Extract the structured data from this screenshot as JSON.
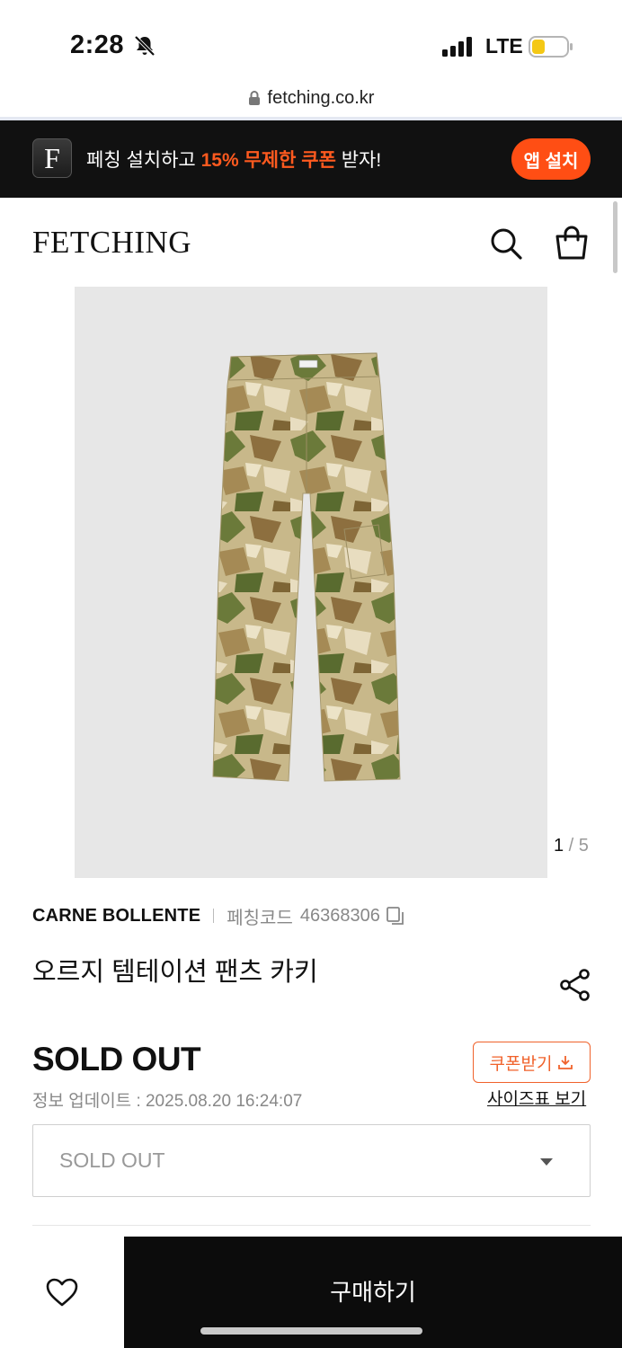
{
  "status_bar": {
    "time": "2:28",
    "network": "LTE",
    "icons": [
      "bell-slash-icon",
      "signal-icon",
      "battery-icon"
    ]
  },
  "browser": {
    "url": "fetching.co.kr"
  },
  "app_banner": {
    "logo_letter": "F",
    "text_prefix": "페칭 설치하고 ",
    "text_highlight": "15% 무제한 쿠폰",
    "text_suffix": " 받자!",
    "install_label": "앱 설치",
    "accent_color": "#ff4e14"
  },
  "header": {
    "logo": "FETCHING",
    "icons": [
      "search-icon",
      "shopping-bag-icon"
    ]
  },
  "product": {
    "image_counter": {
      "current": "1",
      "separator": " / ",
      "total": "5"
    },
    "brand": "CARNE BOLLENTE",
    "code_label": "페칭코드",
    "code_value": "46368306",
    "title": "오르지 템테이션 팬츠 카키",
    "status": "SOLD OUT",
    "update_info": "정보 업데이트 : 2025.08.20 16:24:07",
    "coupon_label": "쿠폰받기",
    "size_chart_label": "사이즈표 보기",
    "option_value": "SOLD OUT"
  },
  "bottom_bar": {
    "buy_label": "구매하기"
  }
}
